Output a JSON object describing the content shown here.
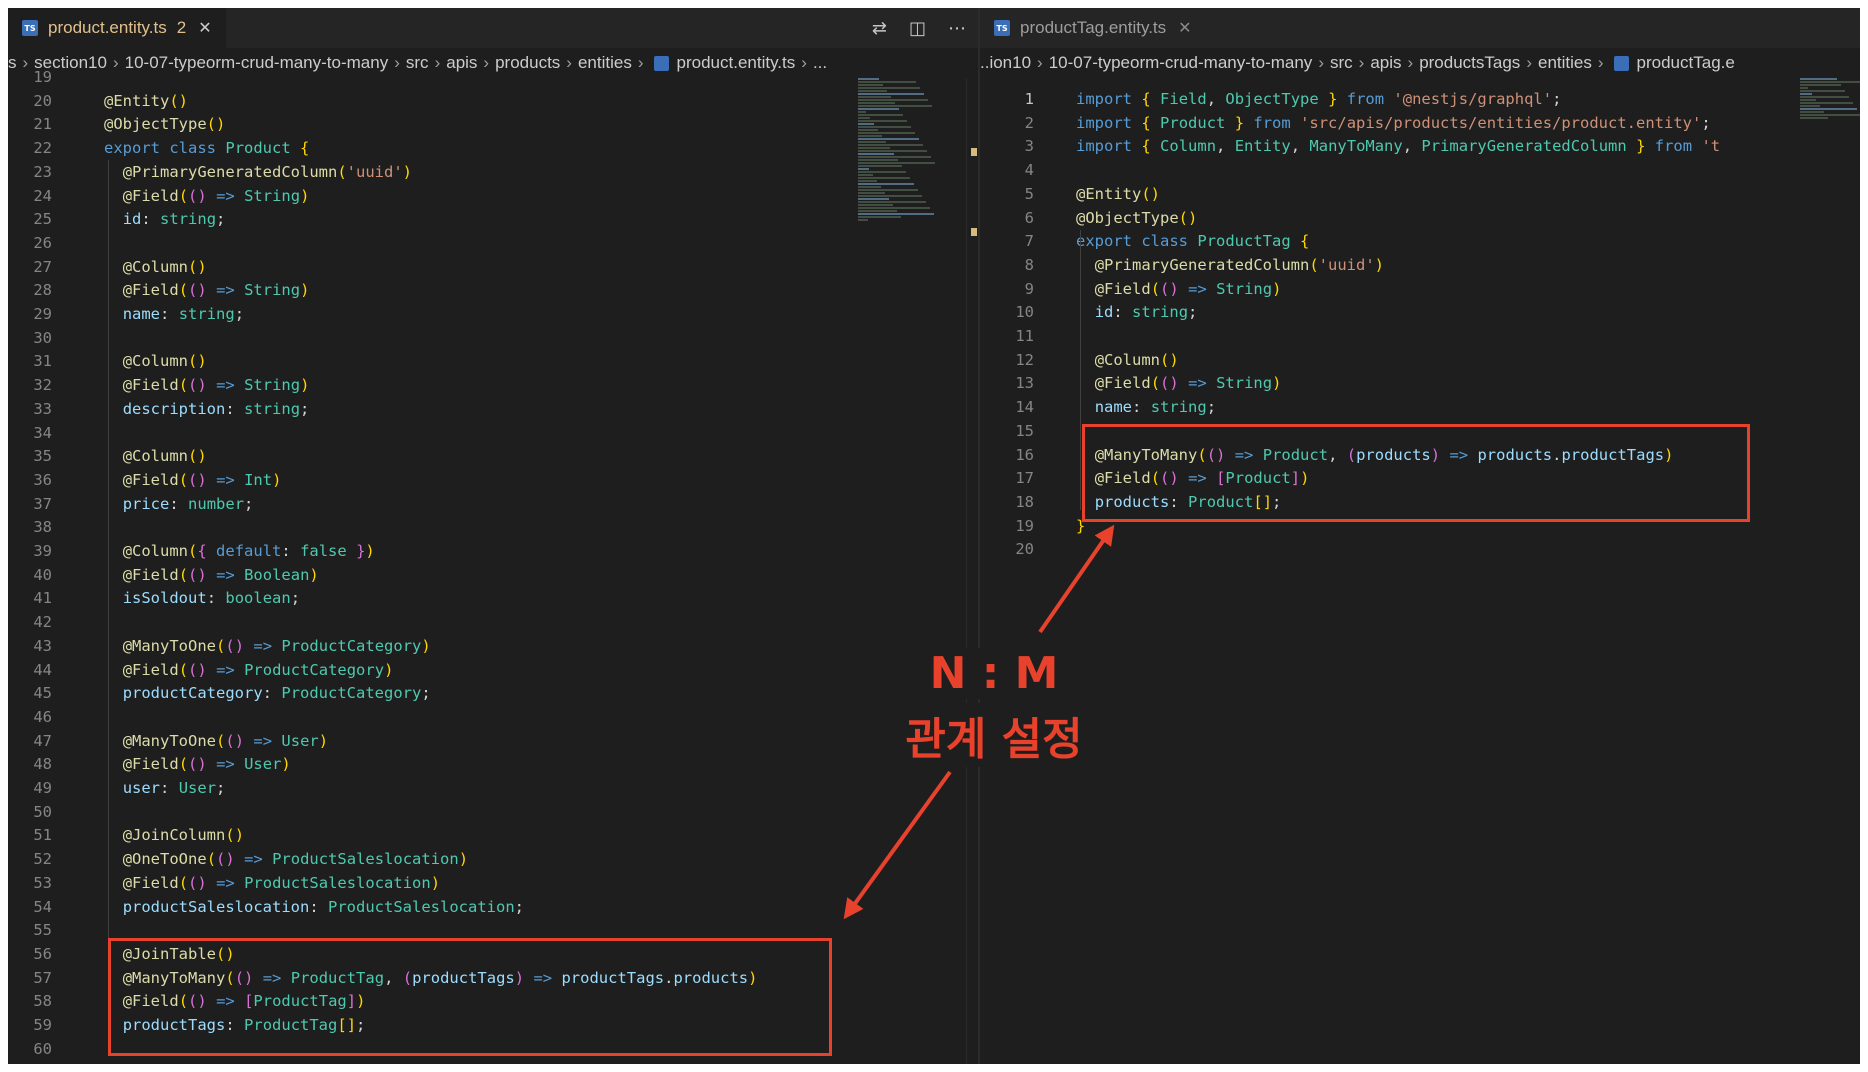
{
  "left_editor": {
    "tab": {
      "title": "product.entity.ts",
      "badge": "2",
      "close": "✕"
    },
    "actions": [
      "compare-icon",
      "split-editor-icon",
      "more-icon"
    ],
    "breadcrumb": [
      "s",
      "section10",
      "10-07-typeorm-crud-many-to-many",
      "src",
      "apis",
      "products",
      "entities",
      "product.entity.ts",
      "..."
    ],
    "line_numbers": [
      "19",
      "20",
      "21",
      "22",
      "23",
      "24",
      "25",
      "26",
      "27",
      "28",
      "29",
      "30",
      "31",
      "32",
      "33",
      "34",
      "35",
      "36",
      "37",
      "38",
      "39",
      "40",
      "41",
      "42",
      "43",
      "44",
      "45",
      "46",
      "47",
      "48",
      "49",
      "50",
      "51",
      "52",
      "53",
      "54",
      "55",
      "56",
      "57",
      "58",
      "59",
      "60"
    ],
    "code_lines": [
      "",
      "@Entity()",
      "@ObjectType()",
      "export class Product {",
      "  @PrimaryGeneratedColumn('uuid')",
      "  @Field(() => String)",
      "  id: string;",
      "",
      "  @Column()",
      "  @Field(() => String)",
      "  name: string;",
      "",
      "  @Column()",
      "  @Field(() => String)",
      "  description: string;",
      "",
      "  @Column()",
      "  @Field(() => Int)",
      "  price: number;",
      "",
      "  @Column({ default: false })",
      "  @Field(() => Boolean)",
      "  isSoldout: boolean;",
      "",
      "  @ManyToOne(() => ProductCategory)",
      "  @Field(() => ProductCategory)",
      "  productCategory: ProductCategory;",
      "",
      "  @ManyToOne(() => User)",
      "  @Field(() => User)",
      "  user: User;",
      "",
      "  @JoinColumn()",
      "  @OneToOne(() => ProductSaleslocation)",
      "  @Field(() => ProductSaleslocation)",
      "  productSaleslocation: ProductSaleslocation;",
      "",
      "  @JoinTable()",
      "  @ManyToMany(() => ProductTag, (productTags) => productTags.products)",
      "  @Field(() => [ProductTag])",
      "  productTags: ProductTag[];",
      ""
    ]
  },
  "right_editor": {
    "tab": {
      "title": "productTag.entity.ts",
      "close": "✕"
    },
    "breadcrumb": [
      "..ion10",
      "10-07-typeorm-crud-many-to-many",
      "src",
      "apis",
      "productsTags",
      "entities",
      "productTag.e"
    ],
    "line_numbers": [
      "1",
      "2",
      "3",
      "4",
      "5",
      "6",
      "7",
      "8",
      "9",
      "10",
      "11",
      "12",
      "13",
      "14",
      "15",
      "16",
      "17",
      "18",
      "19",
      "20"
    ],
    "code_lines": [
      "import { Field, ObjectType } from '@nestjs/graphql';",
      "import { Product } from 'src/apis/products/entities/product.entity';",
      "import { Column, Entity, ManyToMany, PrimaryGeneratedColumn } from 't",
      "",
      "@Entity()",
      "@ObjectType()",
      "export class ProductTag {",
      "  @PrimaryGeneratedColumn('uuid')",
      "  @Field(() => String)",
      "  id: string;",
      "",
      "  @Column()",
      "  @Field(() => String)",
      "  name: string;",
      "",
      "  @ManyToMany(() => Product, (products) => products.productTags)",
      "  @Field(() => [Product])",
      "  products: Product[];",
      "}",
      ""
    ]
  },
  "annotation": {
    "line1": "N : M",
    "line2": "관계 설정"
  },
  "colors": {
    "highlight": "#e8422d",
    "editor_bg": "#1e1e1e",
    "active_tab_text": "#e2c08d"
  }
}
